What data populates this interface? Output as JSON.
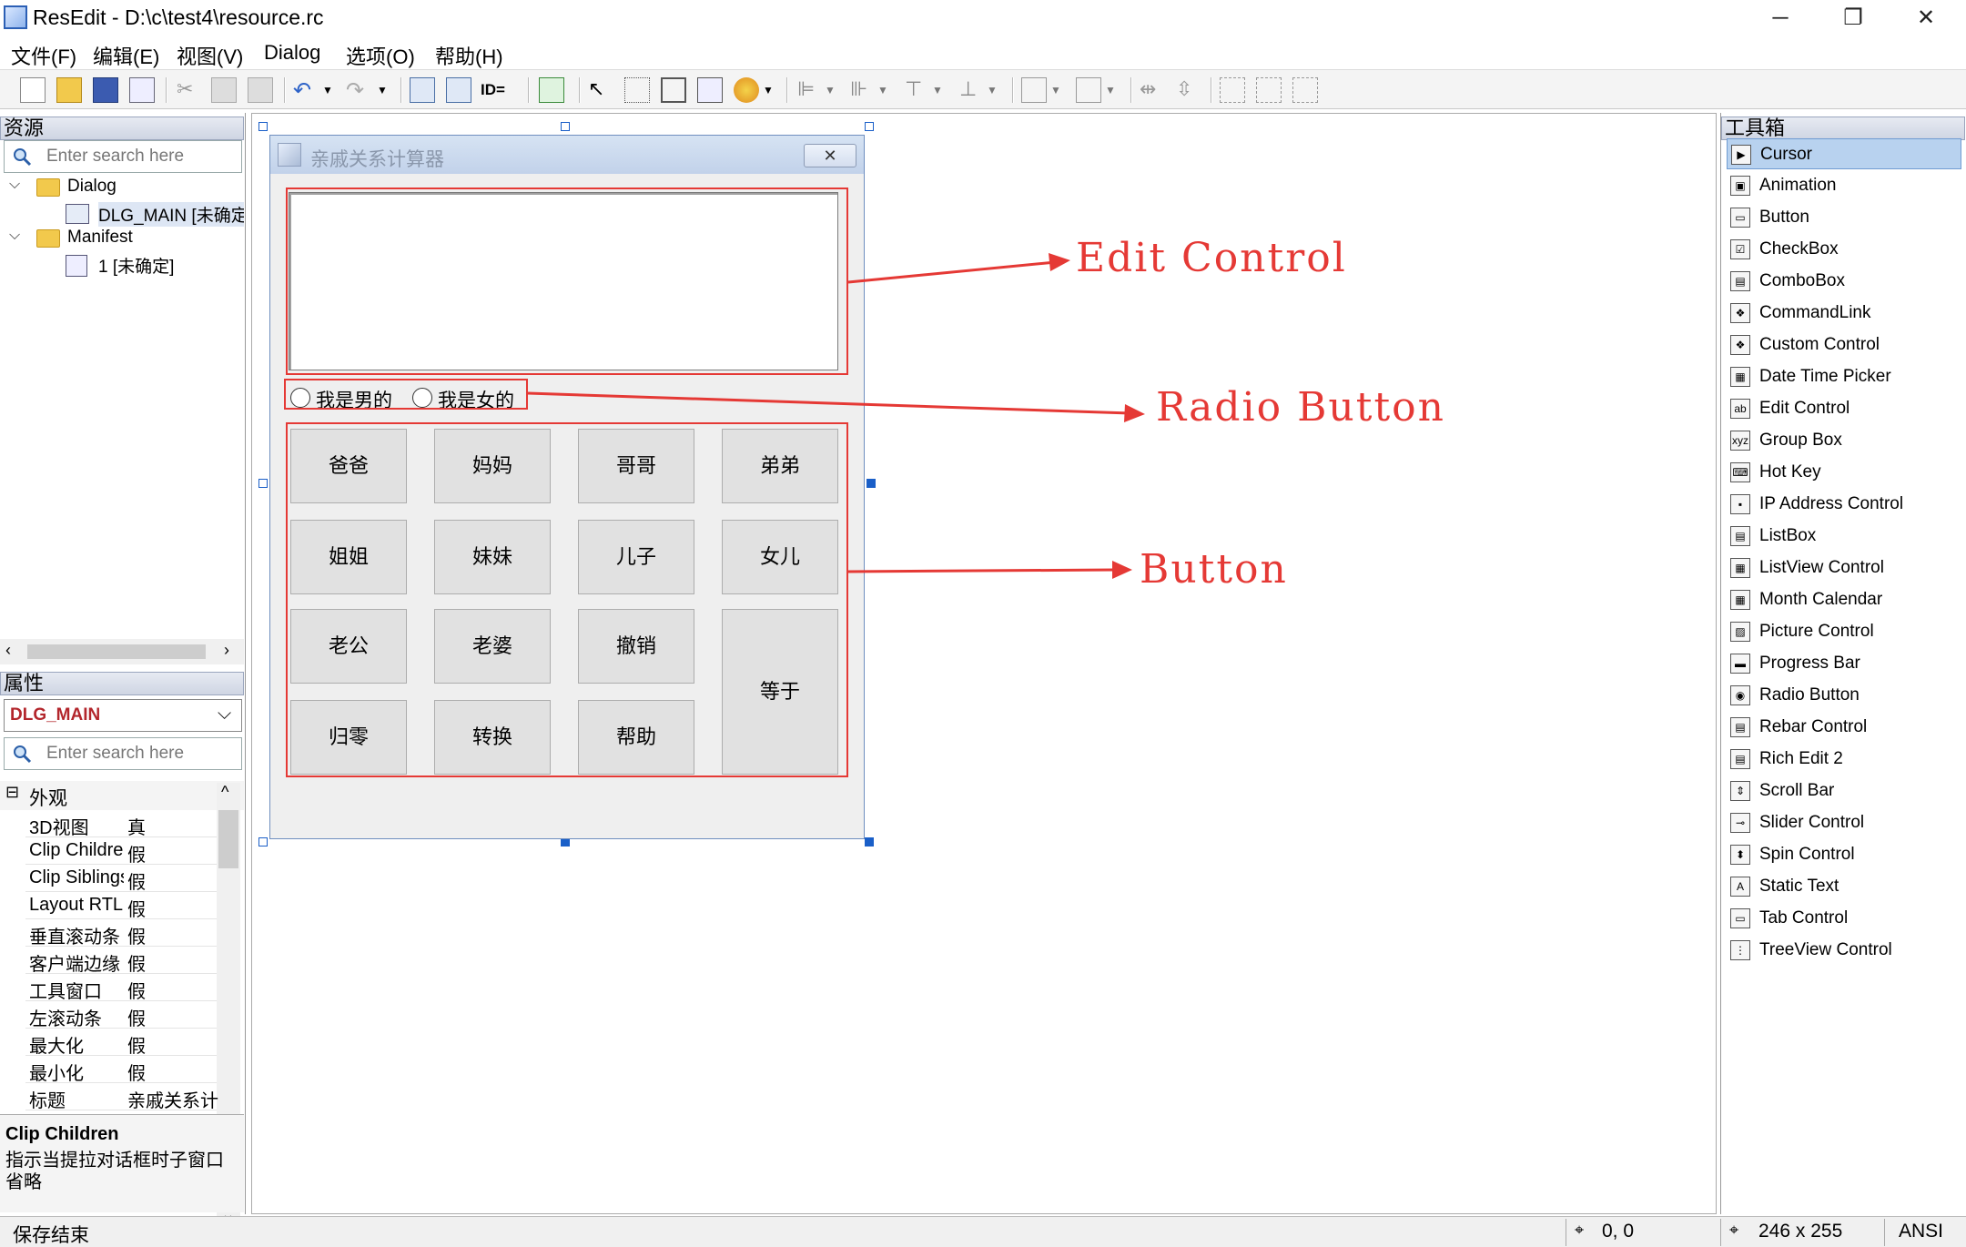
{
  "window": {
    "title": "ResEdit - D:\\c\\test4\\resource.rc",
    "minimize": "─",
    "restore": "❐",
    "close": "✕"
  },
  "menu": [
    "文件(F)",
    "编辑(E)",
    "视图(V)",
    "Dialog",
    "选项(O)",
    "帮助(H)"
  ],
  "resources_panel": {
    "title": "资源",
    "search_placeholder": "Enter search here",
    "tree": {
      "dialog_label": "Dialog",
      "dialog_child": "DLG_MAIN [未确定",
      "manifest_label": "Manifest",
      "manifest_child": "1 [未确定]"
    }
  },
  "properties_panel": {
    "title": "属性",
    "selected_object": "DLG_MAIN",
    "search_placeholder": "Enter search here",
    "category": "外观",
    "rows": [
      {
        "key": "3D视图",
        "value": "真"
      },
      {
        "key": "Clip Children",
        "value": "假"
      },
      {
        "key": "Clip Siblings",
        "value": "假"
      },
      {
        "key": "Layout RTL",
        "value": "假"
      },
      {
        "key": "垂直滚动条",
        "value": "假"
      },
      {
        "key": "客户端边缘",
        "value": "假"
      },
      {
        "key": "工具窗口",
        "value": "假"
      },
      {
        "key": "左滚动条",
        "value": "假"
      },
      {
        "key": "最大化",
        "value": "假"
      },
      {
        "key": "最小化",
        "value": "假"
      },
      {
        "key": "标题",
        "value": "亲戚关系计"
      }
    ],
    "description_title": "Clip Children",
    "description_text": "指示当提拉对话框时子窗口省略"
  },
  "dialog": {
    "title": "亲戚关系计算器",
    "radio_male": "我是男的",
    "radio_female": "我是女的",
    "buttons": {
      "r1": [
        "爸爸",
        "妈妈",
        "哥哥",
        "弟弟"
      ],
      "r2": [
        "姐姐",
        "妹妹",
        "儿子",
        "女儿"
      ],
      "r3": [
        "老公",
        "老婆",
        "撤销"
      ],
      "r4": [
        "归零",
        "转换",
        "帮助"
      ],
      "equals": "等于"
    }
  },
  "annotations": {
    "edit": "Edit  Control",
    "radio": "Radio  Button",
    "button": "Button"
  },
  "colors": {
    "annotation": "#e53935",
    "selection": "#b8d2ef"
  },
  "toolbox": {
    "title": "工具箱",
    "items": [
      "Cursor",
      "Animation",
      "Button",
      "CheckBox",
      "ComboBox",
      "CommandLink",
      "Custom Control",
      "Date Time Picker",
      "Edit Control",
      "Group Box",
      "Hot Key",
      "IP Address Control",
      "ListBox",
      "ListView Control",
      "Month Calendar",
      "Picture Control",
      "Progress Bar",
      "Radio Button",
      "Rebar Control",
      "Rich Edit 2",
      "Scroll Bar",
      "Slider Control",
      "Spin Control",
      "Static Text",
      "Tab Control",
      "TreeView Control"
    ],
    "icons": [
      "▶",
      "▣",
      "▭",
      "☑",
      "▤",
      "❖",
      "❖",
      "▦",
      "ab",
      "xyz",
      "⌨",
      "▪",
      "▤",
      "▦",
      "▦",
      "▨",
      "▬",
      "◉",
      "▤",
      "▤",
      "⇕",
      "⊸",
      "⬍",
      "A",
      "▭",
      "⋮"
    ]
  },
  "status": {
    "message": "保存结束",
    "position": "0, 0",
    "size": "246 x 255",
    "encoding": "ANSI"
  }
}
